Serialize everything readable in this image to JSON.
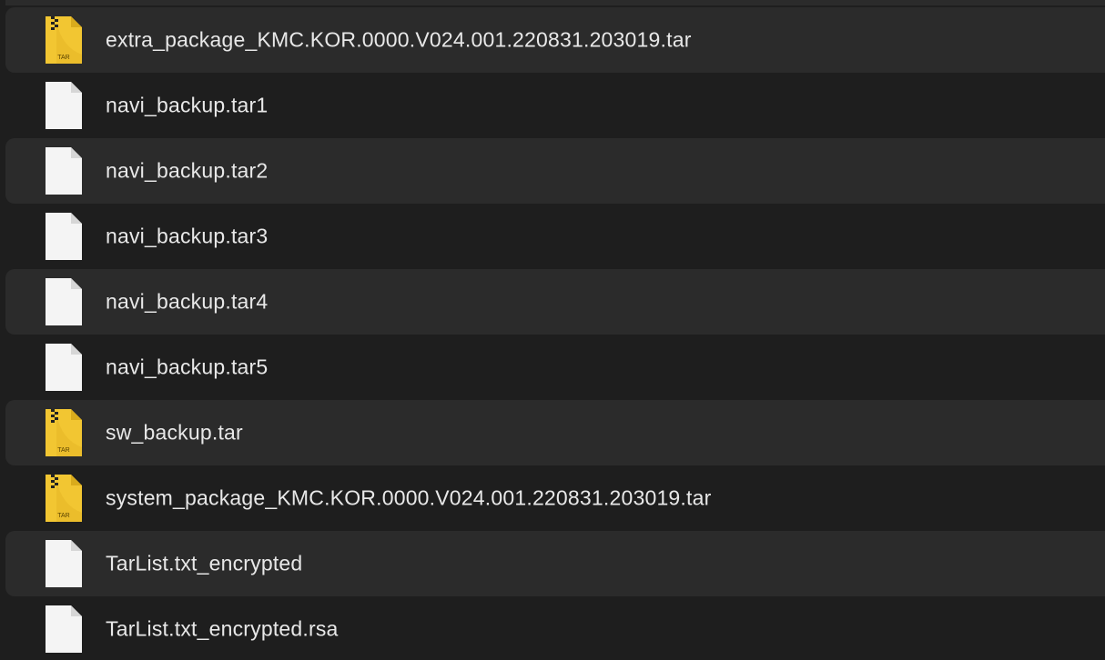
{
  "files": [
    {
      "name": "extra_package_KMC.KOR.0000.V024.001.220831.203019.tar",
      "icon": "tar-archive-icon",
      "badge": "TAR"
    },
    {
      "name": "navi_backup.tar1",
      "icon": "document-icon"
    },
    {
      "name": "navi_backup.tar2",
      "icon": "document-icon"
    },
    {
      "name": "navi_backup.tar3",
      "icon": "document-icon"
    },
    {
      "name": "navi_backup.tar4",
      "icon": "document-icon"
    },
    {
      "name": "navi_backup.tar5",
      "icon": "document-icon"
    },
    {
      "name": "sw_backup.tar",
      "icon": "tar-archive-icon",
      "badge": "TAR"
    },
    {
      "name": "system_package_KMC.KOR.0000.V024.001.220831.203019.tar",
      "icon": "tar-archive-icon",
      "badge": "TAR"
    },
    {
      "name": "TarList.txt_encrypted",
      "icon": "document-icon"
    },
    {
      "name": "TarList.txt_encrypted.rsa",
      "icon": "document-icon"
    }
  ],
  "colors": {
    "background": "#1e1e1e",
    "row_alt": "#2b2b2b",
    "text": "#e8e8e8",
    "tar_icon": "#f2c632"
  }
}
